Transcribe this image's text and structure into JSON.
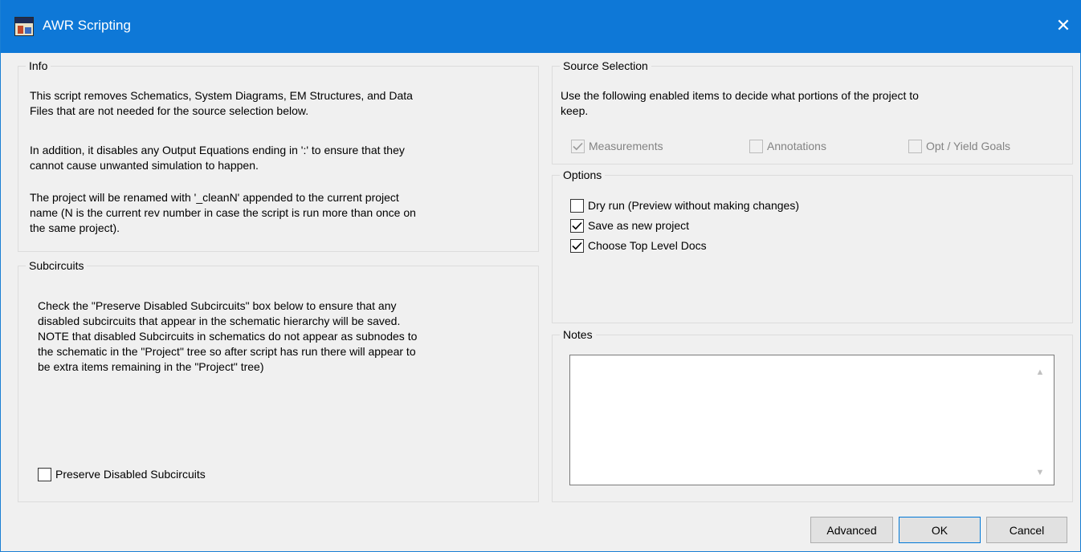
{
  "window": {
    "title": "AWR Scripting",
    "close_glyph": "✕",
    "icon": "app-icon"
  },
  "info": {
    "legend": "Info",
    "paragraph1_line1": "This script removes Schematics, System Diagrams, EM Structures, and Data",
    "paragraph1_line2": "Files that are not needed for the source selection below.",
    "paragraph2_line1": "In addition, it disables any Output Equations ending in ':' to ensure that they",
    "paragraph2_line2": "cannot cause unwanted simulation to happen.",
    "paragraph3_line1": "The project will be renamed with '_cleanN' appended to the current project",
    "paragraph3_line2": "name (N is the current rev number in case the script is run more than once on",
    "paragraph3_line3": "the same project)."
  },
  "subcircuits": {
    "legend": "Subcircuits",
    "line1": "Check the \"Preserve Disabled Subcircuits\" box below to ensure that any",
    "line2": "disabled subcircuits that appear in the schematic hierarchy will be saved.",
    "line3": "NOTE that disabled Subcircuits in schematics do not appear as subnodes to",
    "line4": "the schematic in the \"Project\" tree so after script has run there will appear to",
    "line5": "be extra items remaining in the \"Project\" tree)",
    "preserve_label": "Preserve Disabled Subcircuits",
    "preserve_checked": false
  },
  "source_selection": {
    "legend": "Source Selection",
    "line1": "Use the following enabled items to decide what portions of the project to",
    "line2": "keep.",
    "measurements_label": "Measurements",
    "measurements_checked": true,
    "annotations_label": "Annotations",
    "annotations_checked": false,
    "goals_label": "Opt / Yield Goals",
    "goals_checked": false
  },
  "options": {
    "legend": "Options",
    "dry_run_label": "Dry run (Preview without making changes)",
    "dry_run_checked": false,
    "save_new_label": "Save as new project",
    "save_new_checked": true,
    "top_level_label": "Choose Top Level Docs",
    "top_level_checked": true
  },
  "notes": {
    "legend": "Notes",
    "value": ""
  },
  "buttons": {
    "advanced": "Advanced",
    "ok": "OK",
    "cancel": "Cancel"
  },
  "colors": {
    "titlebar": "#0e78d7",
    "background": "#f0f0f0",
    "disabled_text": "#838383"
  }
}
